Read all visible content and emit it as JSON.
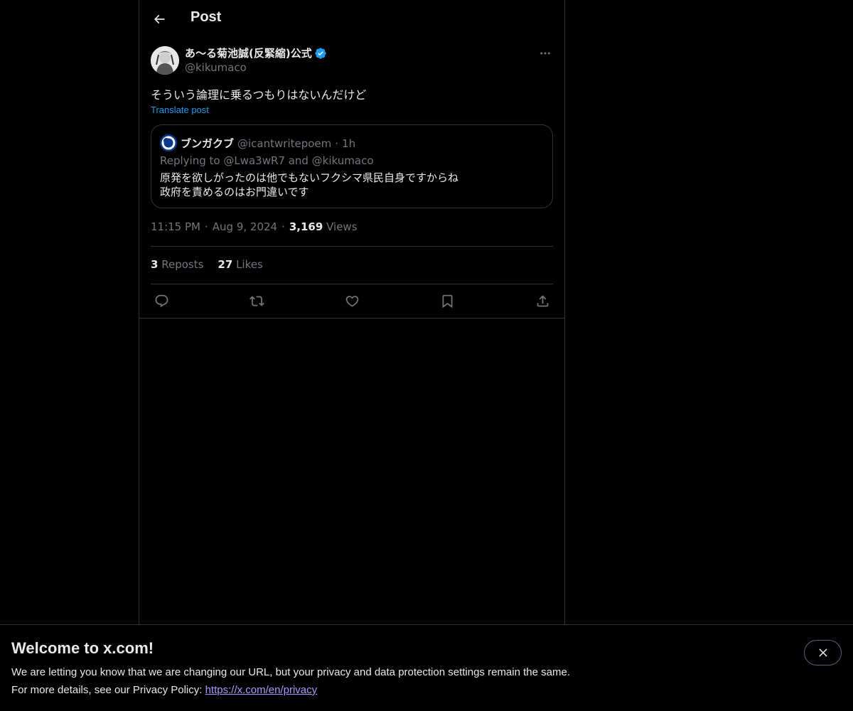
{
  "header": {
    "title": "Post"
  },
  "post": {
    "author_name": "あ〜る菊池誠(反緊縮)公式",
    "author_handle": "@kikumaco",
    "text": "そういう論理に乗るつもりはないんだけど",
    "translate_label": "Translate post",
    "time": "11:15 PM",
    "date": "Aug 9, 2024",
    "views_count": "3,169",
    "views_label": "Views",
    "separator": "·",
    "reposts_count": "3",
    "reposts_label": "Reposts",
    "likes_count": "27",
    "likes_label": "Likes"
  },
  "quote": {
    "name": "ブンガクブ",
    "handle": "@icantwritepoem",
    "separator": "·",
    "age": "1h",
    "replying": "Replying to @Lwa3wR7 and @kikumaco",
    "line1": "原発を欲しがったのは他でもないフクシマ県民自身ですからね",
    "line2": "政府を責めるのはお門違いです"
  },
  "banner": {
    "title": "Welcome to x.com!",
    "line1": "We are letting you know that we are changing our URL, but your privacy and data protection settings remain the same.",
    "line2_prefix": "For more details, see our Privacy Policy: ",
    "link": "https://x.com/en/privacy"
  },
  "icons": {
    "back": "arrow-left-icon",
    "more": "more-icon",
    "verified": "verified-badge-icon",
    "reply": "reply-icon",
    "repost": "repost-icon",
    "like": "heart-icon",
    "bookmark": "bookmark-icon",
    "share": "share-icon",
    "close": "close-icon"
  },
  "colors": {
    "background": "#000000",
    "text": "#e7e9ea",
    "muted": "#71767b",
    "accent": "#1d9bf0",
    "link": "#a79bff",
    "border": "#2f3336"
  }
}
